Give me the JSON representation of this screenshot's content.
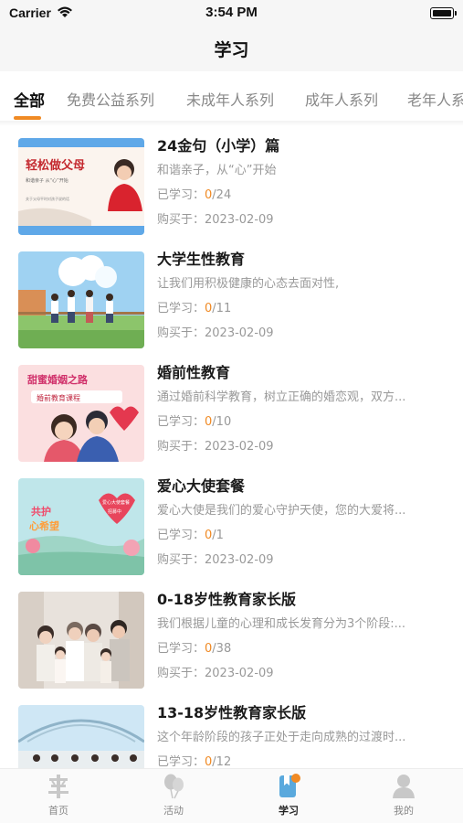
{
  "status_bar": {
    "carrier": "Carrier",
    "time": "3:54 PM"
  },
  "nav": {
    "title": "学习"
  },
  "tabs": [
    {
      "label": "全部",
      "active": true
    },
    {
      "label": "免费公益系列"
    },
    {
      "label": "未成年人系列"
    },
    {
      "label": "成年人系列"
    },
    {
      "label": "老年人系"
    }
  ],
  "labels": {
    "learned": "已学习：",
    "bought": "购买于："
  },
  "courses": [
    {
      "title": "24金句（小学）篇",
      "desc": "和谐亲子，从“心”开始",
      "learned": "0",
      "total": "/24",
      "date": "2023-02-09",
      "thumb_text": "轻松做父母",
      "thumb_sub": "和谐亲子 从“心”开始",
      "thumb_sub2": "关于父母平时对孩子说的话"
    },
    {
      "title": "大学生性教育",
      "desc": "让我们用积极健康的心态去面对性,",
      "learned": "0",
      "total": "/11",
      "date": "2023-02-09"
    },
    {
      "title": "婚前性教育",
      "desc": "通过婚前科学教育，树立正确的婚恋观，双方...",
      "learned": "0",
      "total": "/10",
      "date": "2023-02-09",
      "thumb_text": "甜蜜婚姻之路",
      "thumb_sub": "婚前教育课程"
    },
    {
      "title": "爱心大使套餐",
      "desc": "爱心大使是我们的爱心守护天使，您的大爱将...",
      "learned": "0",
      "total": "/1",
      "date": "2023-02-09",
      "thumb_text": "共护",
      "thumb_text2": "心希望",
      "thumb_sub": "爱心大使套餐",
      "thumb_sub2": "招募中"
    },
    {
      "title": "0-18岁性教育家长版",
      "desc": "我们根据儿童的心理和成长发育分为3个阶段:...",
      "learned": "0",
      "total": "/38",
      "date": "2023-02-09"
    },
    {
      "title": "13-18岁性教育家长版",
      "desc": "这个年龄阶段的孩子正处于走向成熟的过渡时...",
      "learned": "0",
      "total": "/12",
      "date": "2023-02-09"
    }
  ],
  "tabbar": [
    {
      "label": "首页",
      "icon": "home-icon"
    },
    {
      "label": "活动",
      "icon": "balloon-icon"
    },
    {
      "label": "学习",
      "icon": "book-icon",
      "active": true
    },
    {
      "label": "我的",
      "icon": "profile-icon"
    }
  ],
  "colors": {
    "accent": "#f08a24",
    "tab_active": "#111111",
    "muted": "#999999"
  }
}
